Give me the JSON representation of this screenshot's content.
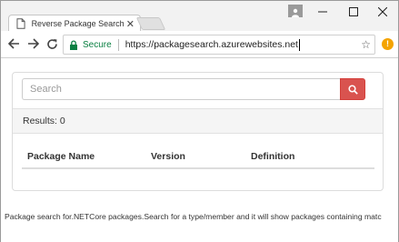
{
  "browser": {
    "tab_title": "Reverse Package Search",
    "tab_close": "✕",
    "secure_label": "Secure",
    "url": "https://packagesearch.azurewebsites.net",
    "alert_badge": "!",
    "icons": {
      "tab": "page-icon",
      "new_tab": "new-tab-icon",
      "profile": "profile-icon",
      "minimize": "minimize-icon",
      "maximize": "maximize-icon",
      "close": "close-icon",
      "back": "back-arrow-icon",
      "forward": "forward-arrow-icon",
      "reload": "reload-icon",
      "lock": "lock-icon",
      "bookmark": "star-icon",
      "alert": "alert-icon"
    },
    "colors": {
      "secure": "#0b8043",
      "alert": "#f4a300"
    }
  },
  "page": {
    "search": {
      "placeholder": "Search",
      "button_icon": "search-icon",
      "button_color": "#d9534f"
    },
    "results_label": "Results: 0",
    "table": {
      "columns": [
        "Package Name",
        "Version",
        "Definition"
      ],
      "rows": []
    },
    "footer": "Package search for.NETCore packages.Search for a type/member and it will show packages containing matc"
  }
}
